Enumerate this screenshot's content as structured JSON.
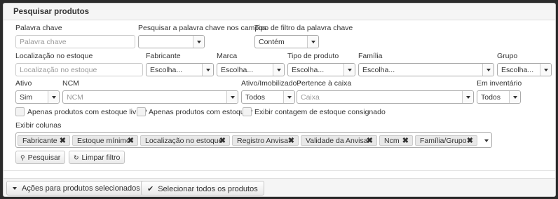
{
  "panel": {
    "title": "Pesquisar produtos"
  },
  "labels": {
    "palavra_chave": "Palavra chave",
    "pesquisar_campos": "Pesquisar a palavra chave nos campos",
    "tipo_filtro": "Tipo de filtro da palavra chave",
    "localizacao": "Localização no estoque",
    "fabricante": "Fabricante",
    "marca": "Marca",
    "tipo_produto": "Tipo de produto",
    "familia": "Família",
    "grupo": "Grupo",
    "ativo": "Ativo",
    "ncm": "NCM",
    "ativo_imobilizado": "Ativo/Imobilizado?",
    "pertence_caixa": "Pertence à caixa",
    "em_inventario": "Em inventário",
    "exibir_colunas": "Exibir colunas"
  },
  "fields": {
    "palavra_chave_placeholder": "Palavra chave",
    "pesquisar_campos_value": "",
    "tipo_filtro_value": "Contém",
    "localizacao_placeholder": "Localização no estoque",
    "fabricante_value": "Escolha...",
    "marca_value": "Escolha...",
    "tipo_produto_value": "Escolha...",
    "familia_value": "Escolha...",
    "grupo_value": "Escolha...",
    "ativo_value": "Sim",
    "ncm_placeholder": "NCM",
    "ativo_imobilizado_value": "Todos",
    "caixa_placeholder": "Caixa",
    "em_inventario_value": "Todos"
  },
  "checkboxes": [
    {
      "label": "Apenas produtos com estoque livre?",
      "checked": false
    },
    {
      "label": "Apenas produtos com estoque?",
      "checked": false
    },
    {
      "label": "Exibir contagem de estoque consignado",
      "checked": false
    }
  ],
  "columns": [
    "Fabricante",
    "Estoque mínimo",
    "Localização no estoque",
    "Registro Anvisa",
    "Validade da Anvisa",
    "Ncm",
    "Família/Grupo"
  ],
  "buttons": {
    "pesquisar": "Pesquisar",
    "limpar": "Limpar filtro",
    "acoes": "Ações para produtos selecionados",
    "selecionar_todos": "Selecionar todos os produtos"
  },
  "icons": {
    "pesquisar": "search-icon",
    "limpar": "refresh-icon",
    "acoes": "caret-down-icon",
    "selecionar_todos": "check-icon",
    "remove_tag": "close-icon"
  }
}
